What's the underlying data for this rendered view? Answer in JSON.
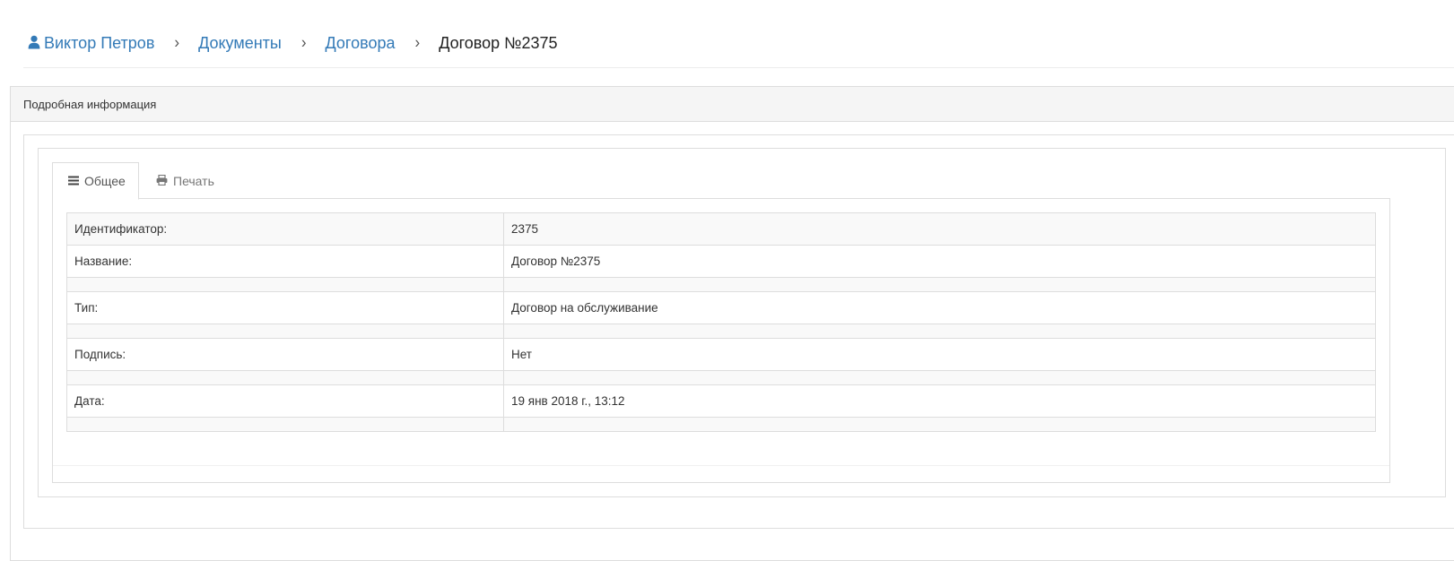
{
  "breadcrumb": {
    "user": "Виктор Петров",
    "documents": "Документы",
    "contracts": "Договора",
    "current": "Договор №2375",
    "separator": "›"
  },
  "panel": {
    "title": "Подробная информация"
  },
  "tabs": [
    {
      "label": "Общее",
      "icon": "list-icon",
      "active": true
    },
    {
      "label": "Печать",
      "icon": "print-icon",
      "active": false
    }
  ],
  "details": [
    {
      "label": "Идентификатор:",
      "value": "2375"
    },
    {
      "label": "Название:",
      "value": "Договор №2375"
    },
    {
      "label": "Тип:",
      "value": "Договор на обслуживание"
    },
    {
      "label": "Подпись:",
      "value": "Нет"
    },
    {
      "label": "Дата:",
      "value": "19 янв 2018 г., 13:12"
    }
  ],
  "colors": {
    "link": "#337ab7",
    "border": "#dddddd",
    "heading_bg": "#f5f5f5",
    "stripe_bg": "#f9f9f9"
  }
}
